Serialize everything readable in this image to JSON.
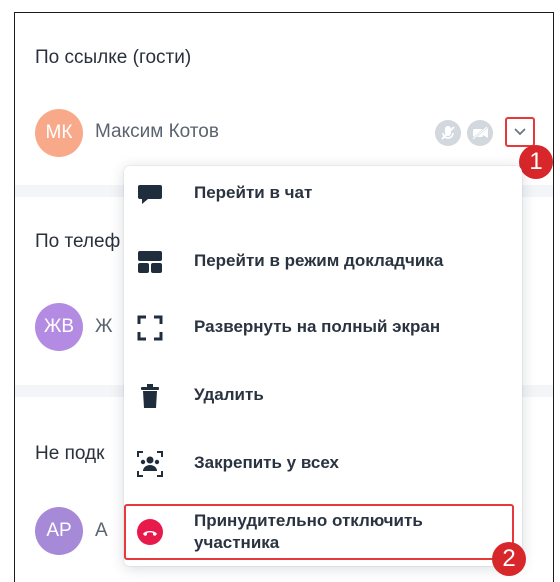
{
  "sections": {
    "guests": {
      "title": "По ссылке (гости)"
    },
    "phone": {
      "title": "По телеф"
    },
    "not_connected": {
      "title": "Не подк"
    }
  },
  "participants": [
    {
      "initials": "МК",
      "name": "Максим Котов",
      "color": "#f8a98a"
    },
    {
      "initials": "ЖВ",
      "name": "Ж",
      "color": "#b48be2"
    },
    {
      "initials": "АР",
      "name": "А",
      "color": "#a68ad8"
    }
  ],
  "menu": {
    "items": [
      {
        "label": "Перейти в чат",
        "icon": "chat-icon"
      },
      {
        "label": "Перейти в режим докладчика",
        "icon": "presenter-mode-icon"
      },
      {
        "label": "Развернуть на полный экран",
        "icon": "fullscreen-icon"
      },
      {
        "label": "Удалить",
        "icon": "trash-icon"
      },
      {
        "label": "Закрепить у всех",
        "icon": "pin-for-all-icon"
      },
      {
        "label": "Принудительно отключить участника",
        "icon": "hangup-icon"
      }
    ]
  },
  "annotations": {
    "step1": "1",
    "step2": "2"
  },
  "colors": {
    "accent_red": "#e5393b",
    "badge_red": "#d8272b",
    "icon_dark": "#1f2d3d"
  }
}
